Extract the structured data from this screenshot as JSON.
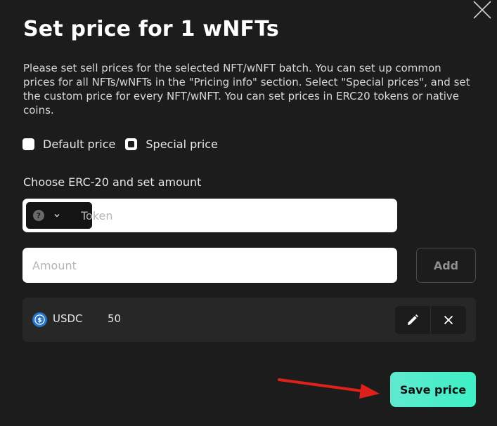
{
  "modal": {
    "title": "Set price for 1 wNFTs",
    "description": "Please set sell prices for the selected NFT/wNFT batch. You can set up common prices for all NFTs/wNFTs in the \"Pricing info\" section. Select \"Special prices\", and set the custom price for every NFT/wNFT. You can set prices in ERC20 tokens or native coins."
  },
  "pricing_mode": {
    "options": [
      {
        "label": "Default price",
        "checked": false
      },
      {
        "label": "Special price",
        "checked": true
      }
    ]
  },
  "erc20": {
    "label": "Choose ERC-20 and set amount",
    "token_select_icon": "question-icon",
    "token_placeholder": "Token",
    "amount_placeholder": "Amount",
    "add_label": "Add"
  },
  "price_list": [
    {
      "token": "USDC",
      "amount": "50",
      "icon": "usdc-icon"
    }
  ],
  "save_label": "Save price",
  "colors": {
    "background": "#1c1c1c",
    "accent": "#3ef0c6",
    "annotation_arrow": "#e0201b",
    "usdc": "#2775ca"
  }
}
